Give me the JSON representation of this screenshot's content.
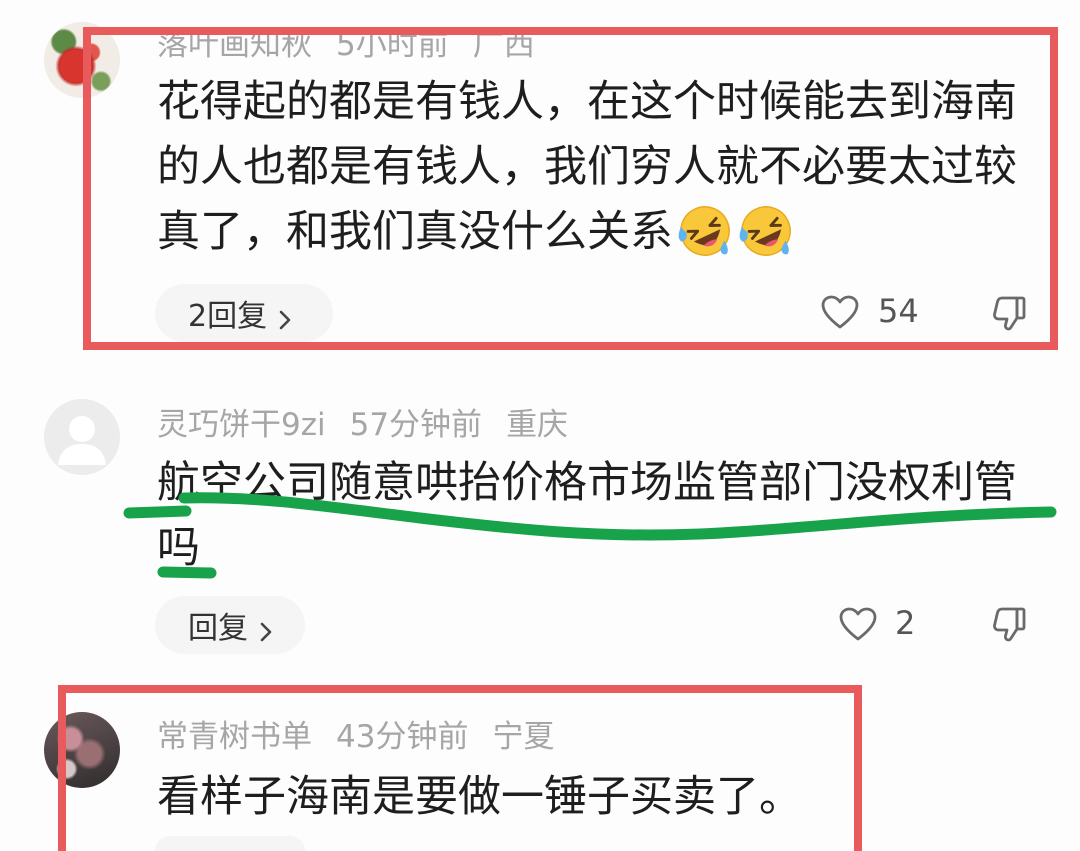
{
  "colors": {
    "highlight_box": "#e85a5c",
    "underline_annotation": "#18a34a",
    "text_primary": "#1e1e1e",
    "text_meta": "#a6a6a6"
  },
  "icons": {
    "like": "heart-outline-icon",
    "dislike": "thumbs-down-outline-icon",
    "reply_chevron": "chevron-right-icon",
    "emoji": "laughing-tears-emoji-icon"
  },
  "comments": [
    {
      "avatar_icon": "flower-photo-avatar",
      "username": "落叶画知秋",
      "time": "5小时前",
      "location": "广西",
      "text": "花得起的都是有钱人，在这个时候能去到海南的人也都是有钱人，我们穷人就不必要太过较真了，和我们真没什么关系",
      "emoji_icons": [
        "laughing-tears-emoji-icon",
        "laughing-tears-emoji-icon"
      ],
      "reply_label": "2回复",
      "like_count": "54"
    },
    {
      "avatar_icon": "default-user-avatar",
      "username": "灵巧饼干9zi",
      "time": "57分钟前",
      "location": "重庆",
      "text": "航空公司随意哄抬价格市场监管部门没权利管吗",
      "reply_label": "回复",
      "like_count": "2"
    },
    {
      "avatar_icon": "photo-avatar",
      "username": "常青树书单",
      "time": "43分钟前",
      "location": "宁夏",
      "text": "看样子海南是要做一锤子买卖了。"
    }
  ]
}
